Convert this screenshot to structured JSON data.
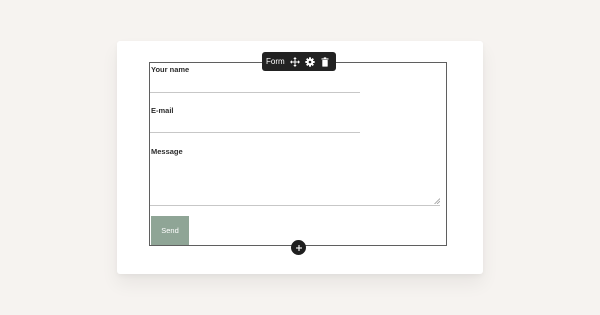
{
  "toolbar": {
    "label": "Form",
    "icons": [
      "move-icon",
      "gear-icon",
      "trash-icon"
    ]
  },
  "form": {
    "name_label": "Your name",
    "email_label": "E-mail",
    "message_label": "Message",
    "send_label": "Send"
  },
  "add_block": {
    "icon": "plus-icon"
  },
  "colors": {
    "background": "#f6f3f0",
    "card": "#ffffff",
    "toolbar": "#222222",
    "send_button": "#8fa596",
    "add_button": "#1f1f1f",
    "form_border": "#5f5f5f",
    "field_line": "#c7c7c7"
  }
}
